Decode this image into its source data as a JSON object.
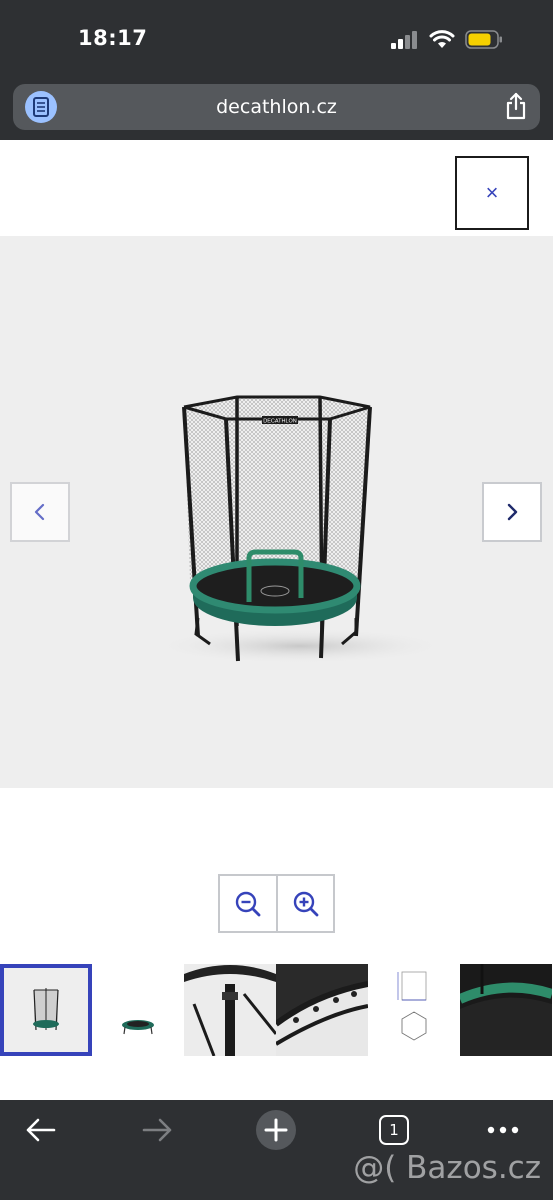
{
  "status_bar": {
    "time": "18:17",
    "signal_icon": "cellular-signal-icon",
    "wifi_icon": "wifi-icon",
    "battery_icon": "battery-icon",
    "battery_color": "#f5d000"
  },
  "browser": {
    "url": "decathlon.cz",
    "reader_icon": "reader-mode-icon",
    "share_icon": "share-icon"
  },
  "gallery": {
    "close_label": "×",
    "prev_icon": "chevron-left-icon",
    "next_icon": "chevron-right-icon",
    "product_logo": "DECATHLON",
    "zoom_out_icon": "zoom-out-icon",
    "zoom_in_icon": "zoom-in-icon",
    "accent_color": "#3643ba",
    "thumbnails": [
      {
        "name": "trampoline-with-net-thumb",
        "selected": true
      },
      {
        "name": "trampoline-without-net-thumb",
        "selected": false
      },
      {
        "name": "trampoline-leg-detail-thumb",
        "selected": false
      },
      {
        "name": "trampoline-springs-detail-thumb",
        "selected": false
      },
      {
        "name": "trampoline-dimensions-thumb",
        "selected": false
      },
      {
        "name": "trampoline-mat-detail-thumb",
        "selected": false
      }
    ]
  },
  "toolbar": {
    "back_icon": "back-arrow-icon",
    "forward_icon": "forward-arrow-icon",
    "new_tab_icon": "plus-icon",
    "tab_count": "1",
    "more_icon": "more-dots-icon"
  },
  "watermark": "@( Bazos.cz"
}
